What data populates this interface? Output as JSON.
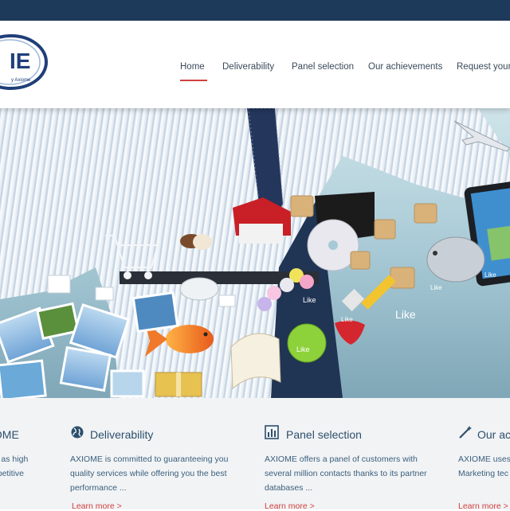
{
  "colors": {
    "topbar": "#1e3a5a",
    "accent": "#d0413e",
    "nav_text": "#3a4a5a",
    "feature_title": "#2d4f6c",
    "feature_text": "#3b5f7c",
    "features_bg": "#f1f3f5"
  },
  "logo": {
    "text": "IE",
    "tagline": "y Axiome",
    "icon": "axiome-logo"
  },
  "nav": {
    "items": [
      {
        "label": "Home",
        "active": true
      },
      {
        "label": "Deliverability",
        "active": false
      },
      {
        "label": "Panel selection",
        "active": false
      },
      {
        "label": "Our achievements",
        "active": false
      },
      {
        "label": "Request your q",
        "active": false
      }
    ]
  },
  "hero": {
    "description": "Businessman releasing a stream of marketing objects from his pocket",
    "like_labels": [
      "Like",
      "Like",
      "Like",
      "Like",
      "Like",
      "Like"
    ]
  },
  "features": [
    {
      "title": "IOME",
      "text": "ell as high\nmpetitive",
      "link": "",
      "icon": ""
    },
    {
      "title": "Deliverability",
      "text": "AXIOME is committed to guaranteeing you\nquality services while offering you the best\nperformance ...",
      "link": "Learn more >",
      "icon": "globe-icon"
    },
    {
      "title": "Panel selection",
      "text": "AXIOME offers a panel of customers with\nseveral million contacts thanks to its partner\ndatabases ...",
      "link": "Learn more >",
      "icon": "bar-chart-icon"
    },
    {
      "title": "Our ac",
      "text": "AXIOME uses\nMarketing tec",
      "link": "Learn more >",
      "icon": "magic-wand-icon"
    }
  ]
}
